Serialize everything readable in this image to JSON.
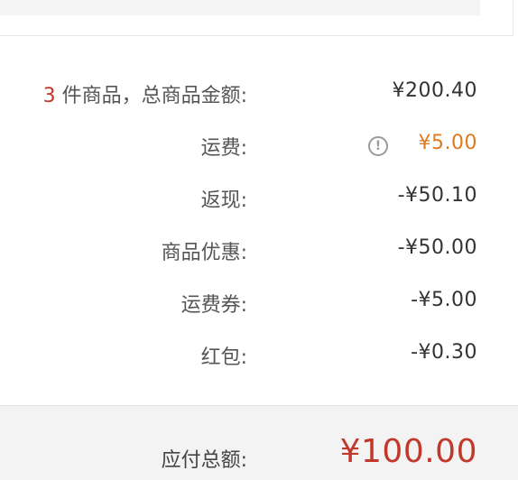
{
  "summary": {
    "items_count": "3",
    "items_label": " 件商品，总商品金额:",
    "items_amount": "¥200.40",
    "shipping_label": "运费:",
    "shipping_amount": "¥5.00",
    "shipping_info_icon": "info-icon",
    "cashback_label": "返现:",
    "cashback_amount": "-¥50.10",
    "discount_label": "商品优惠:",
    "discount_amount": "-¥50.00",
    "shipping_coupon_label": "运费券:",
    "shipping_coupon_amount": "-¥5.00",
    "redpacket_label": "红包:",
    "redpacket_amount": "-¥0.30"
  },
  "total": {
    "label": "应付总额:",
    "amount": "¥100.00"
  },
  "colors": {
    "accent_red": "#c0392b",
    "shipping_orange": "#e07a1f",
    "footer_bg": "#f3f3f3"
  }
}
